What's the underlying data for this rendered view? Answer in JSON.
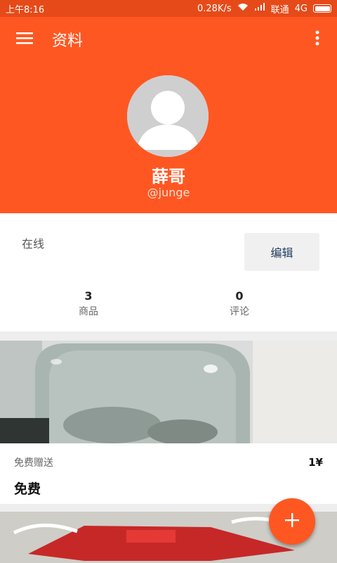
{
  "status_bar": {
    "time": "上午8:16",
    "speed": "0.28K/s",
    "carrier": "联通",
    "network": "4G"
  },
  "app_bar": {
    "title": "资料",
    "menu_icon": "hamburger-menu-icon",
    "more_icon": "more-vert-icon"
  },
  "profile": {
    "name": "薛哥",
    "handle": "@junge",
    "avatar_icon": "default-avatar-icon"
  },
  "info": {
    "status": "在线",
    "edit_label": "编辑",
    "stats": [
      {
        "value": "3",
        "label": "商品"
      },
      {
        "value": "0",
        "label": "评论"
      }
    ]
  },
  "products": [
    {
      "subtitle": "免费赠送",
      "price": "1¥",
      "title": "免费"
    }
  ],
  "fab_icon": "plus-icon",
  "colors": {
    "primary": "#ff5722",
    "status_bar": "#e64a19",
    "background": "#eeeeee"
  }
}
